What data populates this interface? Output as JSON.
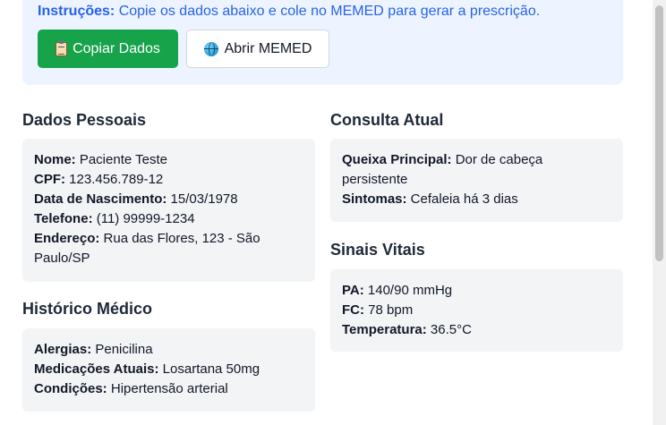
{
  "instructions": {
    "label": "Instruções:",
    "text": " Copie os dados abaixo e cole no MEMED para gerar a prescrição.",
    "copy_button": "Copiar Dados",
    "open_button": "Abrir MEMED"
  },
  "personal": {
    "title": "Dados Pessoais",
    "fields": [
      {
        "label": "Nome:",
        "value": " Paciente Teste"
      },
      {
        "label": "CPF:",
        "value": " 123.456.789-12"
      },
      {
        "label": "Data de Nascimento:",
        "value": " 15/03/1978"
      },
      {
        "label": "Telefone:",
        "value": " (11) 99999-1234"
      },
      {
        "label": "Endereço:",
        "value": " Rua das Flores, 123 - São Paulo/SP"
      }
    ]
  },
  "history": {
    "title": "Histórico Médico",
    "fields": [
      {
        "label": "Alergias:",
        "value": " Penicilina"
      },
      {
        "label": "Medicações Atuais:",
        "value": " Losartana 50mg"
      },
      {
        "label": "Condições:",
        "value": " Hipertensão arterial"
      }
    ]
  },
  "consultation": {
    "title": "Consulta Atual",
    "fields": [
      {
        "label": "Queixa Principal:",
        "value": " Dor de cabeça persistente"
      },
      {
        "label": "Sintomas:",
        "value": " Cefaleia há 3 dias"
      }
    ]
  },
  "vitals": {
    "title": "Sinais Vitais",
    "fields": [
      {
        "label": "PA:",
        "value": " 140/90 mmHg"
      },
      {
        "label": "FC:",
        "value": " 78 bpm"
      },
      {
        "label": "Temperatura:",
        "value": " 36.5°C"
      }
    ]
  }
}
